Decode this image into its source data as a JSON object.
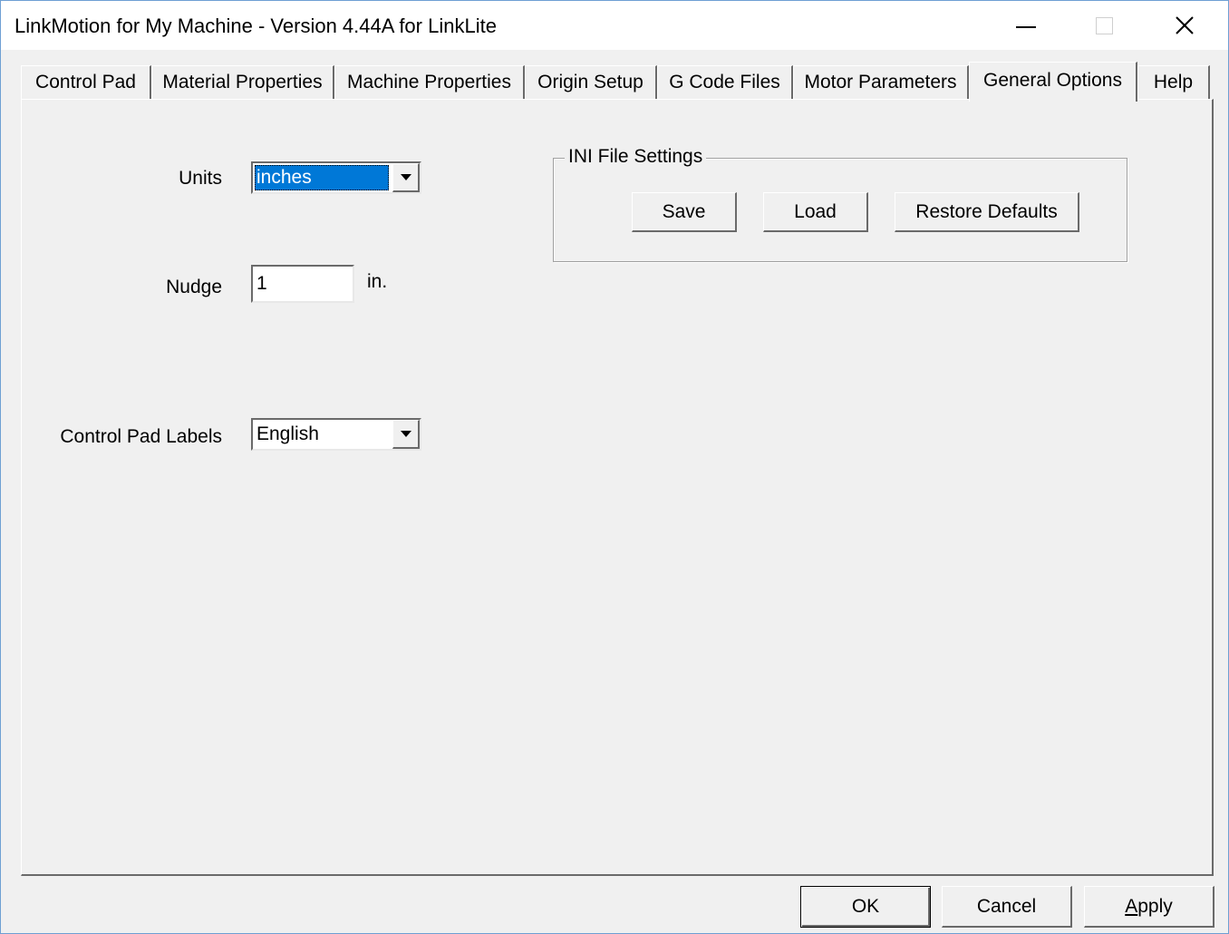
{
  "window": {
    "title": "LinkMotion for My Machine - Version 4.44A for LinkLite"
  },
  "tabs": [
    {
      "label": "Control Pad"
    },
    {
      "label": "Material Properties"
    },
    {
      "label": "Machine Properties"
    },
    {
      "label": "Origin Setup"
    },
    {
      "label": "G Code Files"
    },
    {
      "label": "Motor Parameters"
    },
    {
      "label": "General Options",
      "active": true
    },
    {
      "label": "Help"
    }
  ],
  "general_options": {
    "units": {
      "label": "Units",
      "value": "inches"
    },
    "nudge": {
      "label": "Nudge",
      "value": "1",
      "unit": "in."
    },
    "control_pad_labels": {
      "label": "Control Pad Labels",
      "value": "English"
    },
    "ini_settings": {
      "title": "INI File Settings",
      "save": "Save",
      "load": "Load",
      "restore": "Restore Defaults"
    }
  },
  "footer": {
    "ok": "OK",
    "cancel": "Cancel",
    "apply_accel": "A",
    "apply_rest": "pply"
  },
  "icons": {
    "minimize": "minimize-icon",
    "maximize": "maximize-icon",
    "close": "close-icon",
    "dropdown": "chevron-down-icon"
  }
}
